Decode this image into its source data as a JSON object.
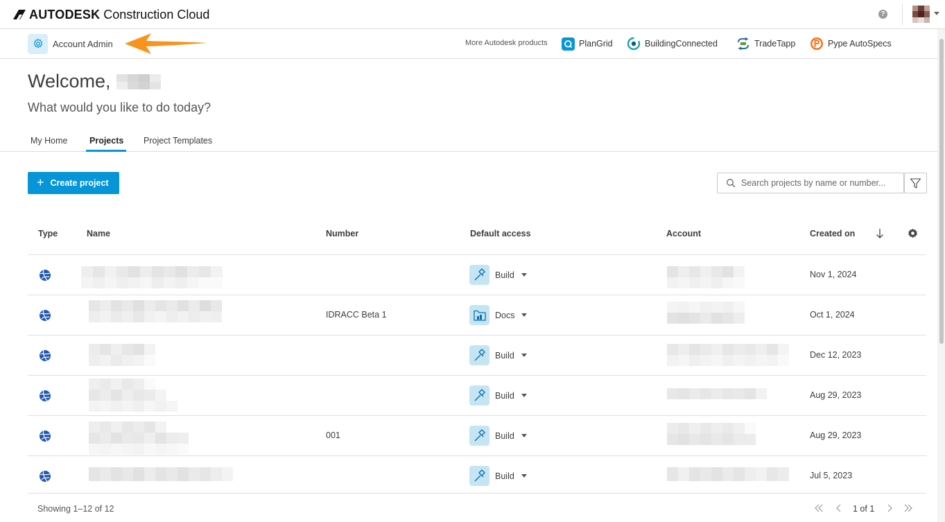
{
  "header": {
    "brand_name": "AUTODESK",
    "brand_product": "Construction Cloud",
    "help_label": "?"
  },
  "subbar": {
    "admin_label": "Account Admin",
    "more_products_label": "More Autodesk products",
    "products": [
      {
        "label": "PlanGrid",
        "icon": "plangrid-icon"
      },
      {
        "label": "BuildingConnected",
        "icon": "buildingconnected-icon"
      },
      {
        "label": "TradeTapp",
        "icon": "tradetapp-icon"
      },
      {
        "label": "Pype AutoSpecs",
        "icon": "pype-autospecs-icon"
      }
    ]
  },
  "welcome": {
    "greeting": "Welcome,",
    "subtitle": "What would you like to do today?"
  },
  "tabs": [
    {
      "label": "My Home",
      "active": false
    },
    {
      "label": "Projects",
      "active": true
    },
    {
      "label": "Project Templates",
      "active": false
    }
  ],
  "toolbar": {
    "create_label": "Create project",
    "search_placeholder": "Search projects by name or number..."
  },
  "table": {
    "columns": [
      "Type",
      "Name",
      "Number",
      "Default access",
      "Account",
      "Created on"
    ],
    "rows": [
      {
        "number": "",
        "access": "Build",
        "created": "Nov 1, 2024"
      },
      {
        "number": "IDRACC Beta 1",
        "access": "Docs",
        "created": "Oct 1, 2024"
      },
      {
        "number": "",
        "access": "Build",
        "created": "Dec 12, 2023"
      },
      {
        "number": "",
        "access": "Build",
        "created": "Aug 29, 2023"
      },
      {
        "number": "001",
        "access": "Build",
        "created": "Aug 29, 2023"
      },
      {
        "number": "",
        "access": "Build",
        "created": "Jul 5, 2023"
      }
    ]
  },
  "footer": {
    "showing": "Showing 1–12 of 12",
    "page_info": "1 of 1"
  },
  "colors": {
    "accent": "#0696d7",
    "arrow": "#f7941d",
    "globe": "#1f58b4"
  }
}
